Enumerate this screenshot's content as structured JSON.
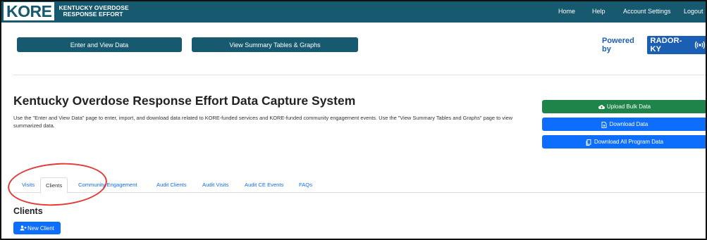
{
  "navbar": {
    "logo_text": "KORE",
    "logo_subtitle_line1": "KENTUCKY OVERDOSE",
    "logo_subtitle_line2": "RESPONSE EFFORT",
    "links": [
      "Home",
      "Help",
      "Account Settings",
      "Logout"
    ]
  },
  "toolbar": {
    "enter_view_label": "Enter and View Data",
    "summary_label": "View Summary Tables & Graphs",
    "powered_by_label": "Powered by",
    "powered_by_brand": "RADOR-KY"
  },
  "header": {
    "title": "Kentucky Overdose Response Effort Data Capture System",
    "description": "Use the \"Enter and View Data\" page to enter, import, and download data related to KORE-funded services and KORE-funded community engagement events. Use the \"View Summary Tables and Graphs\" page to view summarized data."
  },
  "actions": {
    "upload_label": "Upload Bulk Data",
    "download_label": "Download Data",
    "download_all_label": "Download All Program Data"
  },
  "tabs": {
    "items": [
      "Visits",
      "Clients",
      "Community Engagement",
      "Audit Clients",
      "Audit Visits",
      "Audit CE Events",
      "FAQs"
    ],
    "active": "Clients"
  },
  "section": {
    "title": "Clients",
    "new_client_label": "New Client"
  },
  "colors": {
    "navbar": "#17596e",
    "primary_blue": "#0d6efd",
    "success_green": "#1e8449",
    "annotation_red": "#e53935"
  }
}
